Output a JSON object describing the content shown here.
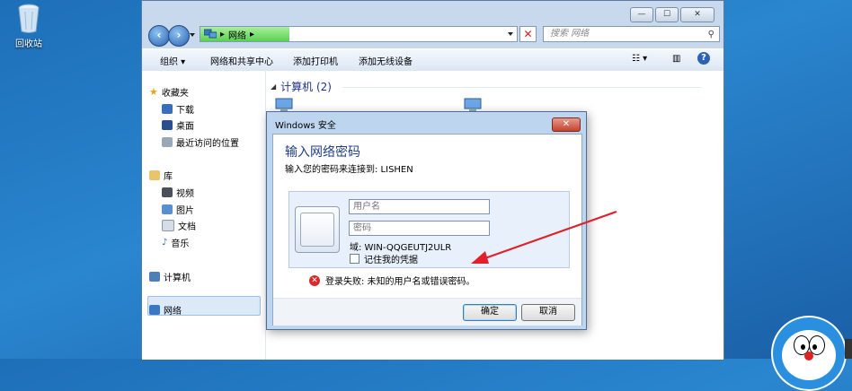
{
  "desktop": {
    "recycle_bin_label": "回收站"
  },
  "explorer": {
    "caption_buttons": [
      "—",
      "☐",
      "✕"
    ],
    "address_crumb": "网络",
    "search_placeholder": "搜索 网络",
    "toolbar": {
      "organize": "组织 ▾",
      "network_sharing": "网络和共享中心",
      "add_printer": "添加打印机",
      "add_wireless": "添加无线设备"
    },
    "nav": {
      "favorites": "收藏夹",
      "downloads": "下载",
      "desktop": "桌面",
      "recent": "最近访问的位置",
      "libraries": "库",
      "videos": "视频",
      "pictures": "图片",
      "documents": "文档",
      "music": "音乐",
      "computer": "计算机",
      "network": "网络"
    },
    "group_header": "计算机 (2)"
  },
  "dialog": {
    "window_title": "Windows 安全",
    "close_glyph": "✕",
    "heading": "输入网络密码",
    "subtitle": "输入您的密码来连接到: LISHEN",
    "username_placeholder": "用户名",
    "password_placeholder": "密码",
    "domain": "域: WIN-QQGEUTJ2ULR",
    "remember_label": "记住我的凭据",
    "error_text": "登录失败: 未知的用户名或错误密码。",
    "ok_label": "确定",
    "cancel_label": "取消"
  },
  "colors": {
    "annotation_arrow": "#e0202a",
    "progress_green": "#5ad152",
    "heading_blue": "#1f3f8c"
  }
}
